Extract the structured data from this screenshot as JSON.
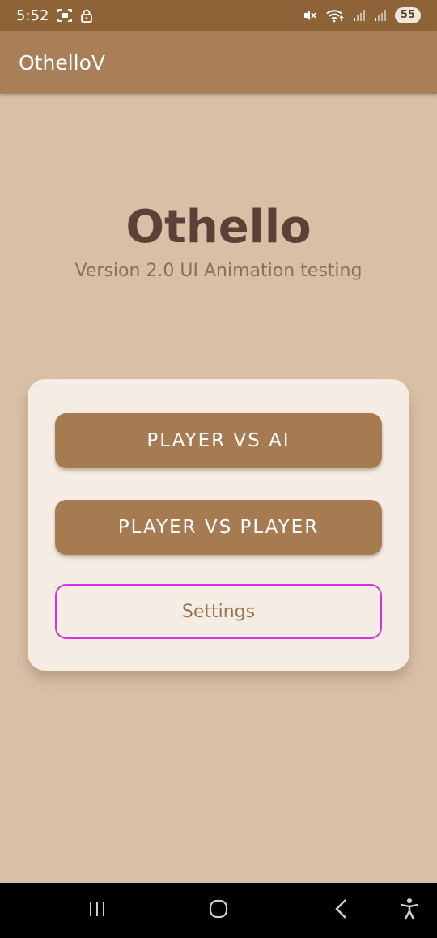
{
  "status_bar": {
    "time": "5:52",
    "battery": "55",
    "left_icons": [
      "screenshot-icon",
      "lock-icon"
    ],
    "right_icons": [
      "mute-icon",
      "wifi-icon",
      "signal-icon",
      "signal-icon"
    ]
  },
  "app_bar": {
    "title": "OthelloV"
  },
  "hero": {
    "title": "Othello",
    "subtitle": "Version 2.0 UI Animation testing"
  },
  "menu": {
    "player_vs_ai_label": "PLAYER VS AI",
    "player_vs_player_label": "PLAYER VS PLAYER",
    "settings_label": "Settings"
  },
  "nav_bar": {
    "buttons": [
      "recents-icon",
      "home-icon",
      "back-icon",
      "accessibility-icon"
    ]
  },
  "colors": {
    "background": "#d8bfa6",
    "status_bar": "#8f6338",
    "app_bar": "#a87f57",
    "primary_button": "#a67b52",
    "card": "#f5ede4",
    "title_text": "#5d4037",
    "settings_border": "#d633e0"
  }
}
